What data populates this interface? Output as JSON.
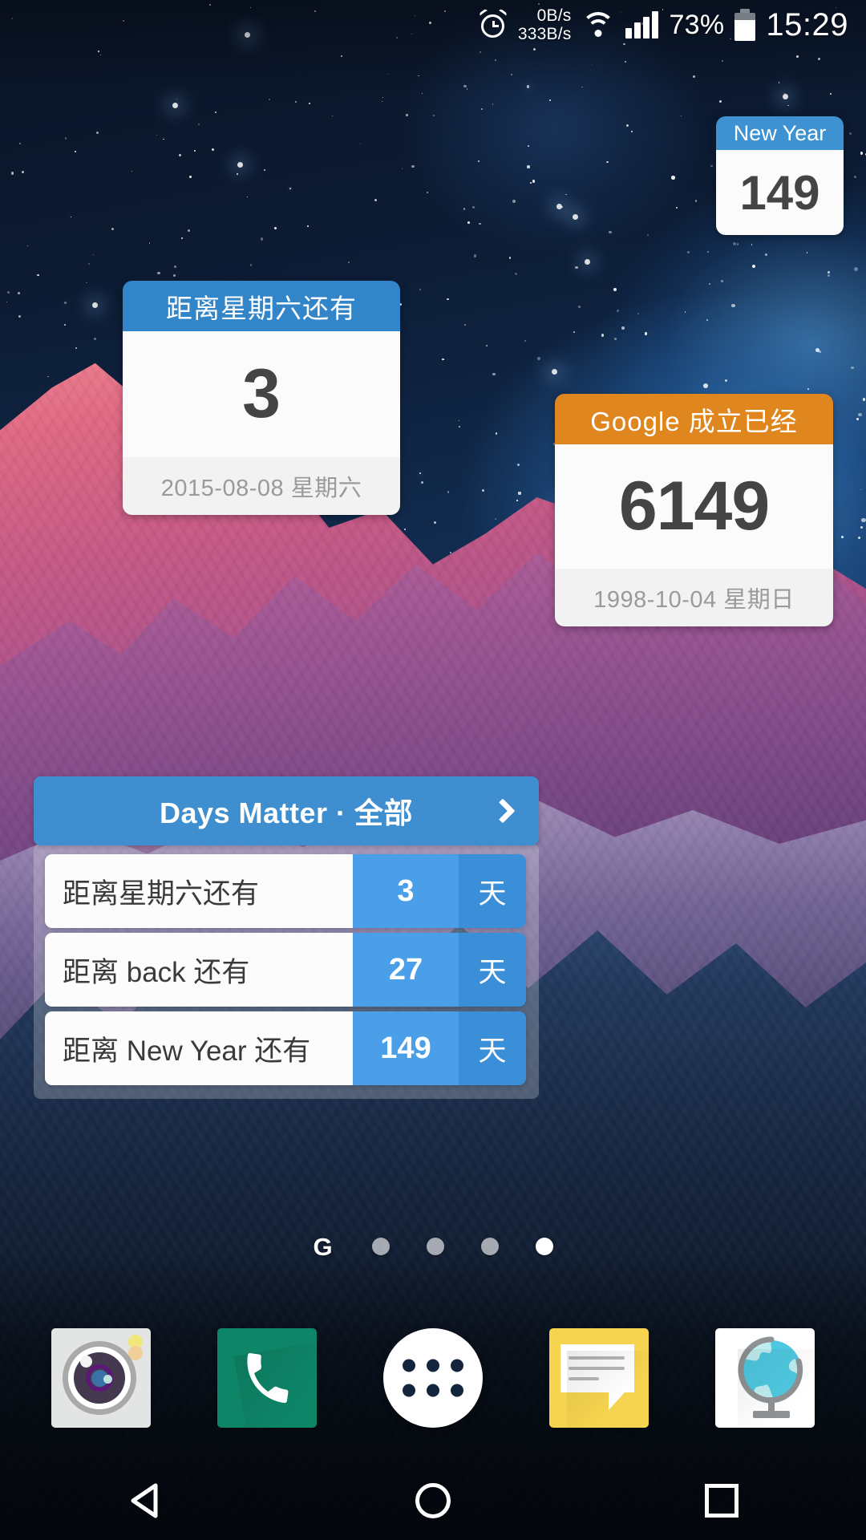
{
  "status_bar": {
    "alarm_icon": "alarm-clock-icon",
    "net_up": "0B/s",
    "net_down": "333B/s",
    "wifi_icon": "wifi-icon",
    "signal_icon": "cellular-signal-icon",
    "battery_percent": "73%",
    "battery_icon": "battery-icon",
    "clock": "15:29"
  },
  "widgets": {
    "new_year": {
      "title": "New Year",
      "days": "149",
      "header_color": "#3f92d2"
    },
    "saturday": {
      "title": "距离星期六还有",
      "days": "3",
      "date": "2015-08-08 星期六",
      "header_color": "#3185c8"
    },
    "google": {
      "title": "Google 成立已经",
      "days": "6149",
      "date": "1998-10-04 星期日",
      "header_color": "#e0861f"
    }
  },
  "days_matter": {
    "header_title": "Days Matter · 全部",
    "header_color": "#3f8fd0",
    "chevron_icon": "chevron-right-icon",
    "unit": "天",
    "rows": [
      {
        "label": "距离星期六还有",
        "value": "3",
        "unit": "天"
      },
      {
        "label": "距离 back 还有",
        "value": "27",
        "unit": "天"
      },
      {
        "label": "距离 New Year 还有",
        "value": "149",
        "unit": "天"
      }
    ],
    "number_color": "#4a9fe8",
    "unit_color": "#3b8fd8"
  },
  "page_indicator": {
    "google_logo": "G",
    "dot_count": 4,
    "active_index": 3
  },
  "dock": {
    "items": [
      {
        "name": "camera",
        "icon": "camera-icon"
      },
      {
        "name": "phone",
        "icon": "phone-icon"
      },
      {
        "name": "app-drawer",
        "icon": "app-drawer-icon"
      },
      {
        "name": "messaging",
        "icon": "message-bubble-icon"
      },
      {
        "name": "browser",
        "icon": "globe-icon"
      }
    ]
  },
  "nav_bar": {
    "back_icon": "back-triangle-icon",
    "home_icon": "home-circle-icon",
    "recents_icon": "recents-square-icon"
  }
}
